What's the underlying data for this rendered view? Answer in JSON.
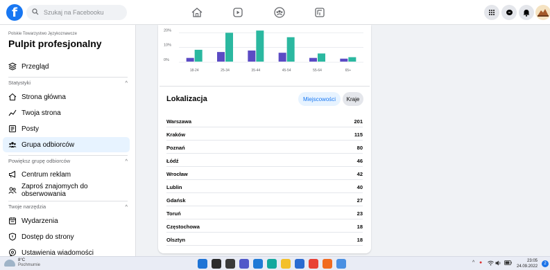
{
  "topbar": {
    "logo": "f",
    "search_placeholder": "Szukaj na Facebooku",
    "nav_icons": [
      "home-icon",
      "watch-icon",
      "groups-icon",
      "gaming-icon"
    ],
    "right_icons": [
      "menu-grid-icon",
      "messenger-icon",
      "notifications-icon",
      "profile-avatar"
    ]
  },
  "sidebar": {
    "org_name": "Polskie Towarzystwo Językoznawcze",
    "title": "Pulpit profesjonalny",
    "overview": "Przegląd",
    "stats_section": "Statystyki",
    "stats_items": [
      {
        "label": "Strona główna",
        "icon": "home-outline-icon"
      },
      {
        "label": "Twoja strona",
        "icon": "trend-line-icon"
      },
      {
        "label": "Posty",
        "icon": "posts-icon"
      },
      {
        "label": "Grupa odbiorców",
        "icon": "people-icon",
        "active": true
      }
    ],
    "grow_section": "Powiększ grupę odbiorców",
    "grow_items": [
      {
        "label": "Centrum reklam",
        "icon": "megaphone-icon"
      },
      {
        "label": "Zaproś znajomych do obserwowania",
        "icon": "invite-friends-icon"
      }
    ],
    "tools_section": "Twoje narzędzia",
    "tools_items": [
      {
        "label": "Wydarzenia",
        "icon": "calendar-icon"
      },
      {
        "label": "Dostęp do strony",
        "icon": "shield-icon"
      },
      {
        "label": "Ustawienia wiadomości",
        "icon": "message-settings-icon"
      }
    ],
    "chevron": "^"
  },
  "chart_data": {
    "type": "bar",
    "categories": [
      "18-24",
      "25-34",
      "35-44",
      "45-54",
      "55-64",
      "65+"
    ],
    "series": [
      {
        "values": [
          2.5,
          6.5,
          7.5,
          6.0,
          2.5,
          2.0
        ],
        "color": "#5b4bc4"
      },
      {
        "values": [
          8.0,
          19.5,
          21.0,
          16.5,
          5.5,
          3.0
        ],
        "color": "#2bb8a0"
      }
    ],
    "yticks": [
      "20%",
      "10%",
      "0%"
    ],
    "ylim": [
      0,
      22
    ]
  },
  "location": {
    "title": "Lokalizacja",
    "btn_cities": "Miejscowości",
    "btn_countries": "Kraje",
    "rows": [
      {
        "city": "Warszawa",
        "count": "201"
      },
      {
        "city": "Kraków",
        "count": "115"
      },
      {
        "city": "Poznań",
        "count": "80"
      },
      {
        "city": "Łódź",
        "count": "46"
      },
      {
        "city": "Wrocław",
        "count": "42"
      },
      {
        "city": "Lublin",
        "count": "40"
      },
      {
        "city": "Gdańsk",
        "count": "27"
      },
      {
        "city": "Toruń",
        "count": "23"
      },
      {
        "city": "Częstochowa",
        "count": "18"
      },
      {
        "city": "Olsztyn",
        "count": "18"
      }
    ]
  },
  "taskbar": {
    "weather_temp": "8°C",
    "weather_desc": "Pochmurnie",
    "time": "23:05",
    "date": "24.09.2022",
    "notif_count": "2",
    "apps": [
      {
        "icon": "start-icon",
        "color": "#1e74d6"
      },
      {
        "icon": "search-icon",
        "color": "#2b2b2b"
      },
      {
        "icon": "task-view-icon",
        "color": "#3a3a3a"
      },
      {
        "icon": "chat-icon",
        "color": "#5059c9"
      },
      {
        "icon": "widgets-icon",
        "color": "#1f7ad6"
      },
      {
        "icon": "edge-icon",
        "color": "#13a89e"
      },
      {
        "icon": "file-explorer-icon",
        "color": "#f3c02a"
      },
      {
        "icon": "store-icon",
        "color": "#2a6bd1"
      },
      {
        "icon": "chrome-icon",
        "color": "#e94235"
      },
      {
        "icon": "firefox-icon",
        "color": "#f16b1f"
      },
      {
        "icon": "notepad-icon",
        "color": "#4a90e2"
      }
    ]
  }
}
